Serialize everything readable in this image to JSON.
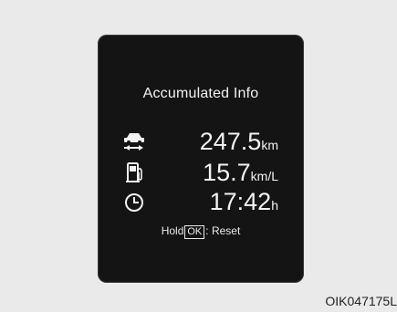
{
  "display": {
    "title": "Accumulated Info",
    "distance": {
      "icon": "car-distance-icon",
      "value": "247.5",
      "unit": "km"
    },
    "fuel": {
      "icon": "fuel-pump-icon",
      "value": "15.7",
      "unit": "km/L"
    },
    "time": {
      "icon": "clock-icon",
      "value": "17:42",
      "unit": "h"
    },
    "hint": {
      "prefix": "Hold",
      "button": "OK",
      "suffix": ": Reset"
    }
  },
  "caption": "OIK047175L"
}
